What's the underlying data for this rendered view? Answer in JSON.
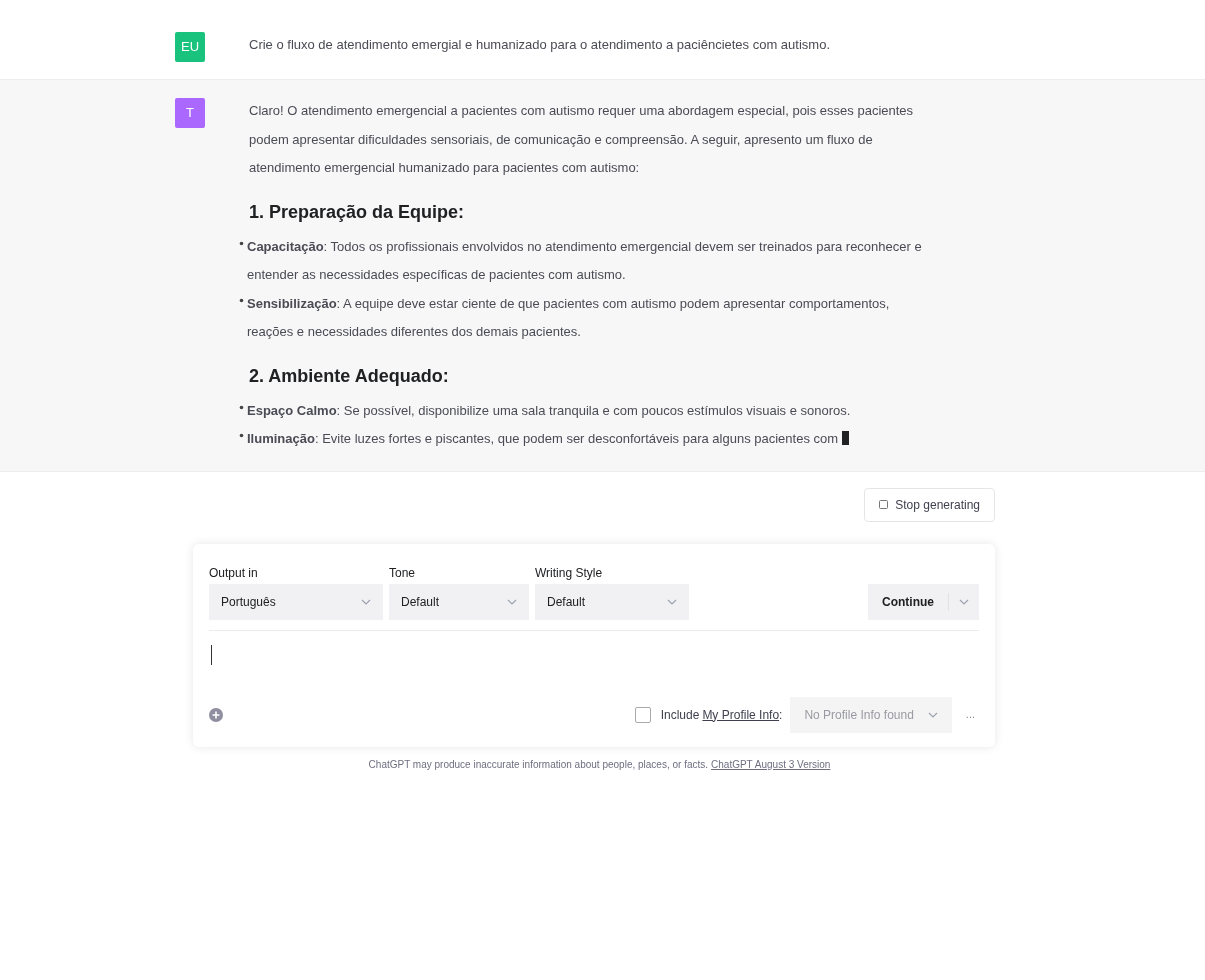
{
  "messages": [
    {
      "kind": "user",
      "avatar": "EU",
      "color": "#19c37d",
      "paragraphs": [
        "Crie o fluxo de atendimento emergial e humanizado para o atendimento a paciêncietes com autismo."
      ]
    },
    {
      "kind": "assistant",
      "avatar": "T",
      "color": "#ab68ff",
      "paragraphs": [
        "Claro! O atendimento emergencial a pacientes com autismo requer uma abordagem especial, pois esses pacientes podem apresentar dificuldades sensoriais, de comunicação e compreensão. A seguir, apresento um fluxo de atendimento emergencial humanizado para pacientes com autismo:"
      ],
      "sections": [
        {
          "heading": "1. Preparação da Equipe:",
          "items": [
            "**Capacitação**: Todos os profissionais envolvidos no atendimento emergencial devem ser treinados para reconhecer e entender as necessidades específicas de pacientes com autismo.",
            "**Sensibilização**: A equipe deve estar ciente de que pacientes com autismo podem apresentar comportamentos, reações e necessidades diferentes dos demais pacientes."
          ]
        },
        {
          "heading": "2. Ambiente Adequado:",
          "items": [
            "**Espaço Calmo**: Se possível, disponibilize uma sala tranquila e com poucos estímulos visuais e sonoros.",
            "**Iluminação**: Evite luzes fortes e piscantes, que podem ser desconfortáveis para alguns pacientes com"
          ]
        }
      ],
      "streaming": true
    }
  ],
  "stop_button": "Stop generating",
  "prompt_panel": {
    "selects": [
      {
        "label": "Output in",
        "value": "Português"
      },
      {
        "label": "Tone",
        "value": "Default"
      },
      {
        "label": "Writing Style",
        "value": "Default"
      }
    ],
    "continue_button": "Continue",
    "input": {
      "focused": true
    },
    "include_profile": {
      "checked": false,
      "prefix": "Include",
      "link": "My Profile Info",
      ":": ":"
    },
    "profile_select": "No Profile Info found",
    "more": "..."
  },
  "footer": {
    "text": "ChatGPT may produce inaccurate information about people, places, or facts.",
    "link": "ChatGPT August 3 Version"
  }
}
